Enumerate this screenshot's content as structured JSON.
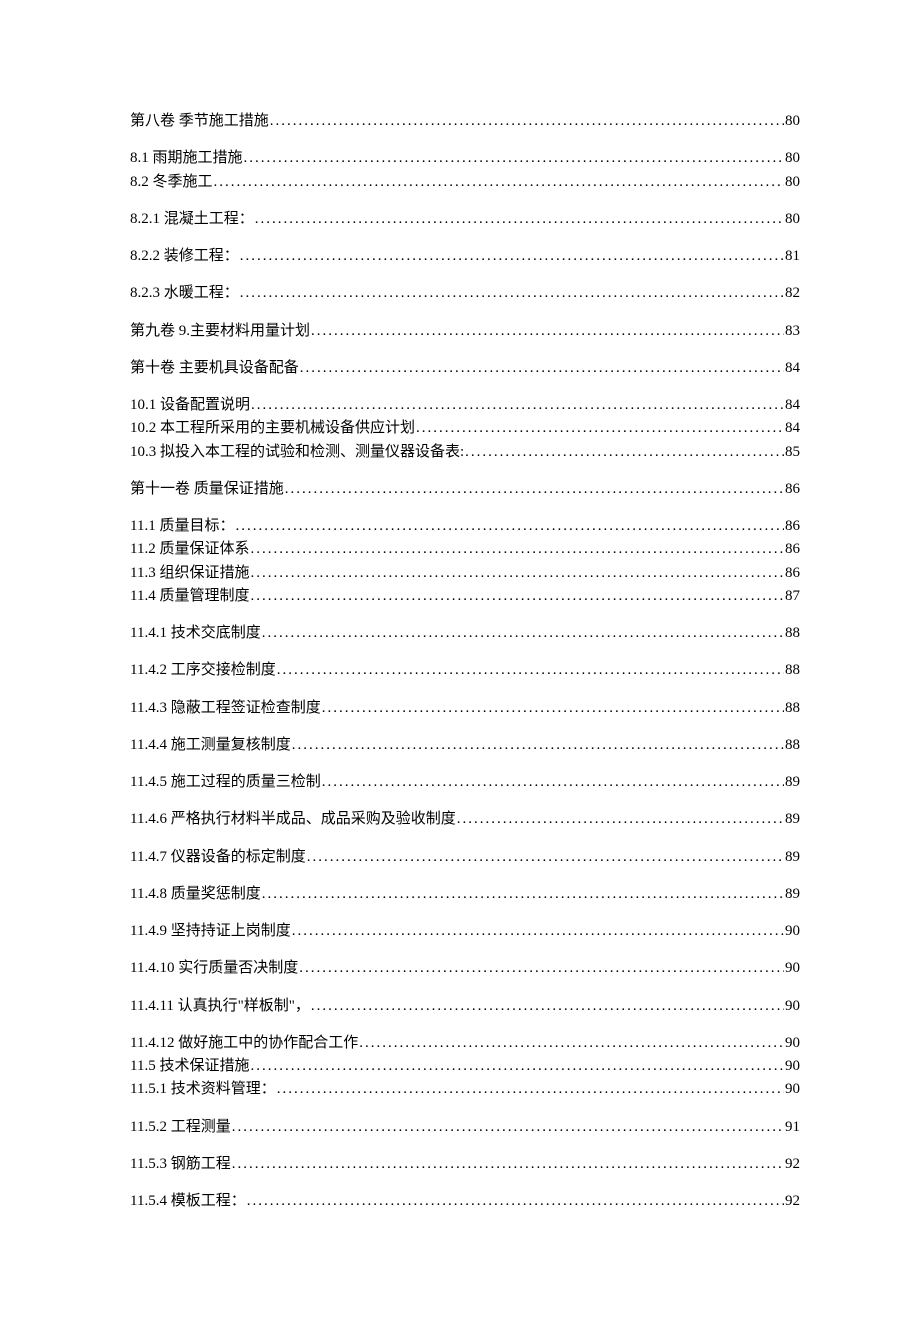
{
  "toc": [
    {
      "title": "第八卷 季节施工措施",
      "page": "80",
      "spaced": false
    },
    {
      "title": "8.1 雨期施工措施",
      "page": "80",
      "spaced": true
    },
    {
      "title": "8.2 冬季施工",
      "page": "80",
      "spaced": false
    },
    {
      "title": "8.2.1 混凝土工程：",
      "page": "80",
      "spaced": true
    },
    {
      "title": "8.2.2 装修工程：",
      "page": "81",
      "spaced": true
    },
    {
      "title": "8.2.3 水暖工程：",
      "page": "82",
      "spaced": true
    },
    {
      "title": "第九卷 9.主要材料用量计划",
      "page": "83",
      "spaced": true
    },
    {
      "title": "第十卷 主要机具设备配备",
      "page": "84",
      "spaced": true
    },
    {
      "title": "10.1 设备配置说明",
      "page": "84",
      "spaced": true
    },
    {
      "title": "10.2 本工程所采用的主要机械设备供应计划",
      "page": "84",
      "spaced": false
    },
    {
      "title": "10.3 拟投入本工程的试验和检测、测量仪器设备表:",
      "page": "85",
      "spaced": false
    },
    {
      "title": "第十一卷 质量保证措施",
      "page": "86",
      "spaced": true
    },
    {
      "title": "11.1 质量目标：",
      "page": "86",
      "spaced": true
    },
    {
      "title": "11.2 质量保证体系",
      "page": "86",
      "spaced": false
    },
    {
      "title": "11.3 组织保证措施",
      "page": "86",
      "spaced": false
    },
    {
      "title": "11.4 质量管理制度",
      "page": "87",
      "spaced": false
    },
    {
      "title": "11.4.1 技术交底制度",
      "page": "88",
      "spaced": true
    },
    {
      "title": "11.4.2 工序交接检制度",
      "page": "88",
      "spaced": true
    },
    {
      "title": "11.4.3 隐蔽工程签证检查制度",
      "page": "88",
      "spaced": true
    },
    {
      "title": "11.4.4 施工测量复核制度",
      "page": "88",
      "spaced": true
    },
    {
      "title": "11.4.5 施工过程的质量三检制",
      "page": "89",
      "spaced": true
    },
    {
      "title": "11.4.6 严格执行材料半成品、成品采购及验收制度",
      "page": "89",
      "spaced": true
    },
    {
      "title": "11.4.7 仪器设备的标定制度",
      "page": "89",
      "spaced": true
    },
    {
      "title": "11.4.8 质量奖惩制度",
      "page": "89",
      "spaced": true
    },
    {
      "title": "11.4.9 坚持持证上岗制度",
      "page": "90",
      "spaced": true
    },
    {
      "title": "11.4.10 实行质量否决制度",
      "page": "90",
      "spaced": true
    },
    {
      "title": "11.4.11 认真执行\"样板制\"，",
      "page": "90",
      "spaced": true
    },
    {
      "title": "11.4.12 做好施工中的协作配合工作",
      "page": "90",
      "spaced": true
    },
    {
      "title": "11.5 技术保证措施",
      "page": "90",
      "spaced": false
    },
    {
      "title": "11.5.1 技术资料管理：",
      "page": "90",
      "spaced": false
    },
    {
      "title": "11.5.2 工程测量",
      "page": "91",
      "spaced": true
    },
    {
      "title": "11.5.3 钢筋工程",
      "page": "92",
      "spaced": true
    },
    {
      "title": "11.5.4 模板工程：",
      "page": "92",
      "spaced": true
    }
  ]
}
